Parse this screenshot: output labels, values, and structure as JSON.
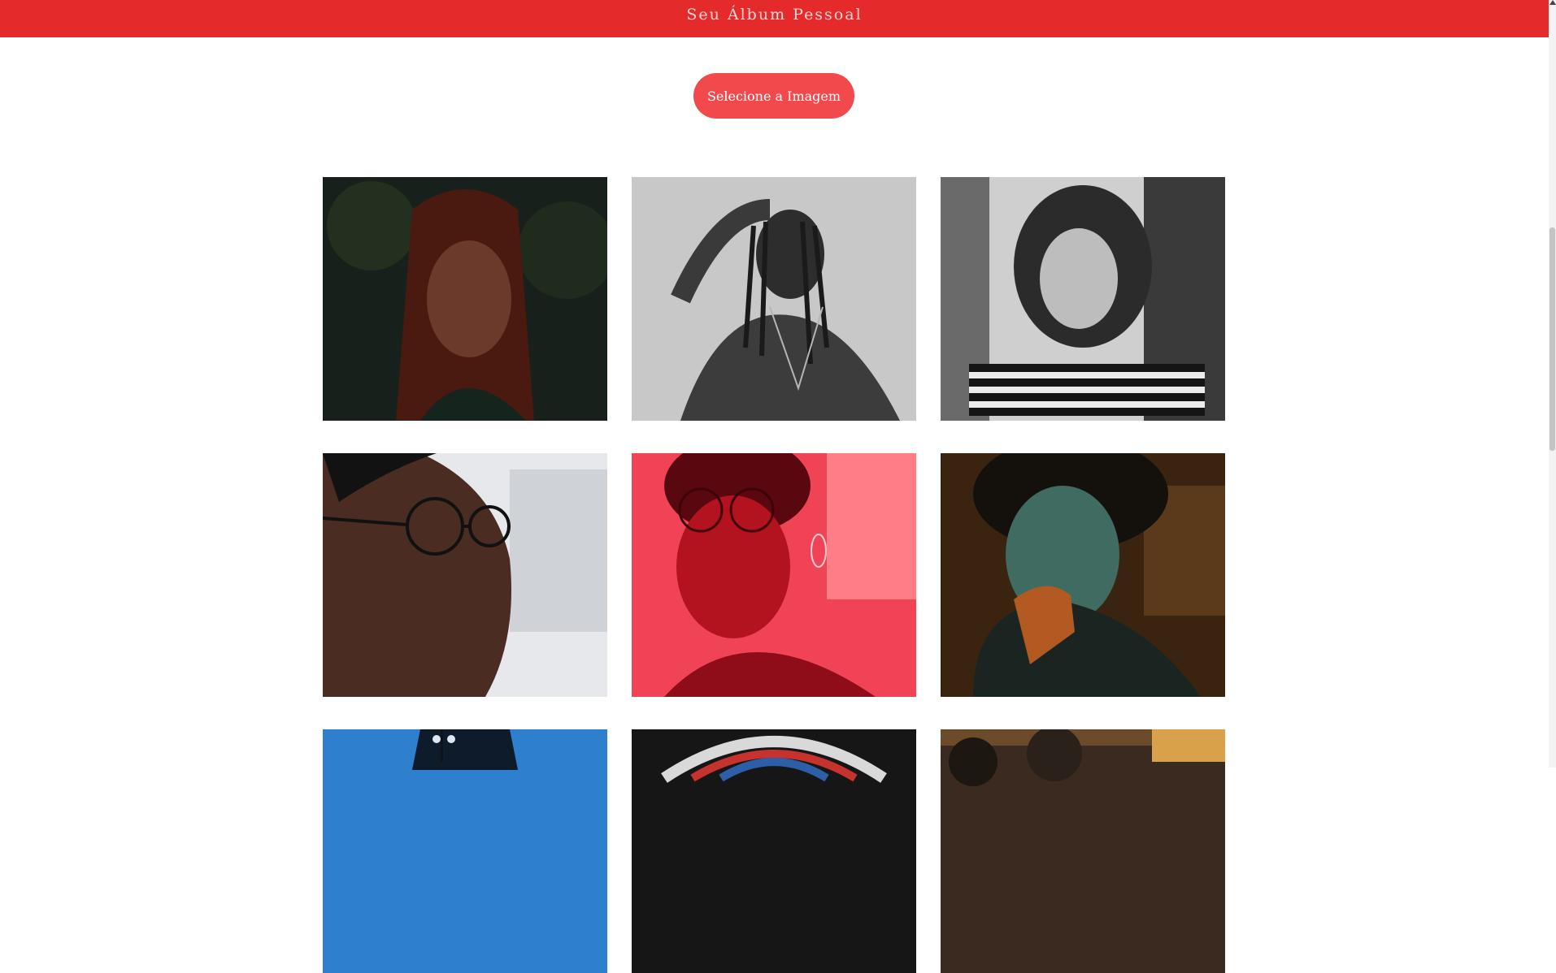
{
  "header": {
    "title": "Seu Álbum Pessoal"
  },
  "upload": {
    "button_label": "Selecione a Imagem"
  },
  "gallery": {
    "photos": [
      {
        "name": "woman-red-hair-dark-foliage",
        "colors": [
          "#1c2418",
          "#3b1a12",
          "#6a2a1c"
        ]
      },
      {
        "name": "man-braids-black-and-white",
        "colors": [
          "#c9c9c9",
          "#3a3a3a",
          "#7a7a7a"
        ]
      },
      {
        "name": "woman-curly-hair-striped-top-bw",
        "colors": [
          "#a9a9a9",
          "#2c2c2c",
          "#e0e0e0"
        ]
      },
      {
        "name": "man-round-glasses-profile",
        "colors": [
          "#e7e9ec",
          "#4a2d22",
          "#b7b9bd"
        ]
      },
      {
        "name": "woman-glasses-red-light",
        "colors": [
          "#e0283a",
          "#7a0b16",
          "#ff6b74"
        ]
      },
      {
        "name": "young-man-orange-teal-light",
        "colors": [
          "#3a2410",
          "#c8651a",
          "#1f3b36"
        ]
      },
      {
        "name": "person-blue-sky-streetlight",
        "colors": [
          "#2f7fcf",
          "#0b1b2f",
          "#6fb3ee"
        ]
      },
      {
        "name": "stained-glass-window",
        "colors": [
          "#1a1a1a",
          "#d9d9d9",
          "#c6322e"
        ]
      },
      {
        "name": "vintage-camera-warm-light",
        "colors": [
          "#3b2a1f",
          "#d9a14a",
          "#1d1712"
        ]
      }
    ]
  }
}
